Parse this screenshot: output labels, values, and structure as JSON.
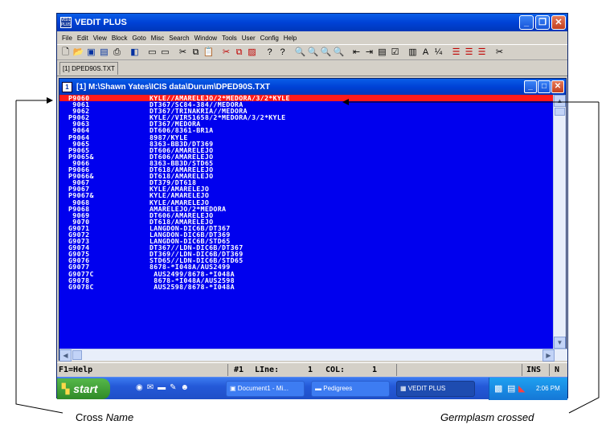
{
  "window": {
    "title": "VEDIT PLUS",
    "app_icon_text": "VEDIT PLUS",
    "minimize": "_",
    "maximize": "❐",
    "close": "✕"
  },
  "menu": [
    "File",
    "Edit",
    "View",
    "Block",
    "Goto",
    "Misc",
    "Search",
    "Window",
    "Tools",
    "User",
    "Config",
    "Help"
  ],
  "doc_tab": "[1] DPED90S.TXT",
  "child": {
    "icon_text": "1",
    "title": "[1]  M:\\Shawn Yates\\ICIS data\\Durum\\DPED90S.TXT"
  },
  "editor_lines": [
    {
      "code": "P9060",
      "pedigree": "KYLE//AMARELEJO/2*MEDORA/3/2*KYLE",
      "highlighted": true
    },
    {
      "code": " 9061",
      "pedigree": "DT367/SC84-384//MEDORA"
    },
    {
      "code": " 9062",
      "pedigree": "DT367/TRINAKRIA//MEDORA"
    },
    {
      "code": "P9062",
      "pedigree": "KYLE//VIR51658/2*MEDORA/3/2*KYLE"
    },
    {
      "code": " 9063",
      "pedigree": "DT367/MEDORA"
    },
    {
      "code": " 9064",
      "pedigree": "DT606/8361-BR1A"
    },
    {
      "code": "P9064",
      "pedigree": "8987/KYLE"
    },
    {
      "code": " 9065",
      "pedigree": "8363-BB3D/DT369"
    },
    {
      "code": "P9065",
      "pedigree": "DT606/AMARELEJO"
    },
    {
      "code": "P9065&",
      "pedigree": "DT606/AMARELEJO"
    },
    {
      "code": " 9066",
      "pedigree": "8363-BB3D/STD65"
    },
    {
      "code": "P9066",
      "pedigree": "DT618/AMARELEJO"
    },
    {
      "code": "P9066&",
      "pedigree": "DT618/AMARELEJO"
    },
    {
      "code": " 9067",
      "pedigree": "DT379/DT618"
    },
    {
      "code": "P9067",
      "pedigree": "KYLE/AMARELEJO"
    },
    {
      "code": "P9067&",
      "pedigree": "KYLE/AMARELEJO"
    },
    {
      "code": " 9068",
      "pedigree": "KYLE/AMARELEJO"
    },
    {
      "code": "P9068",
      "pedigree": "AMARELEJO/2*MEDORA"
    },
    {
      "code": " 9069",
      "pedigree": "DT606/AMARELEJO"
    },
    {
      "code": " 9070",
      "pedigree": "DT618/AMARELEJO"
    },
    {
      "code": "G9071",
      "pedigree": "LANGDON-DIC6B/DT367"
    },
    {
      "code": "G9072",
      "pedigree": "LANGDON-DIC6B/DT369"
    },
    {
      "code": "G9073",
      "pedigree": "LANGDON-DIC6B/STD65"
    },
    {
      "code": "G9074",
      "pedigree": "DT367//LDN-DIC6B/DT367"
    },
    {
      "code": "G9075",
      "pedigree": "DT369//LDN-DIC6B/DT369"
    },
    {
      "code": "G9076",
      "pedigree": "STD65//LDN-DIC6B/STD65"
    },
    {
      "code": "G9077",
      "pedigree": "8678-*I048A/AUS2499"
    },
    {
      "code": "G9077C",
      "pedigree": " AUS2499/8678-*I048A"
    },
    {
      "code": "G9078",
      "pedigree": " 8678-*I048A/AUS2598"
    },
    {
      "code": "G9078C",
      "pedigree": " AUS2598/8678-*I048A"
    }
  ],
  "status": {
    "help": "F1=Help",
    "buffer": "#1",
    "line_label": "LIne:",
    "line_value": "1",
    "col_label": "COL:",
    "col_value": "1",
    "ins": "INS",
    "mode": "N"
  },
  "taskbar": {
    "start": "start",
    "tasks": [
      "Document1 - Mi...",
      "Pedigrees",
      "VEDIT PLUS"
    ],
    "clock": "2:06 PM"
  },
  "annotations": {
    "left": "Cross Name",
    "right": "Germplasm crossed"
  }
}
